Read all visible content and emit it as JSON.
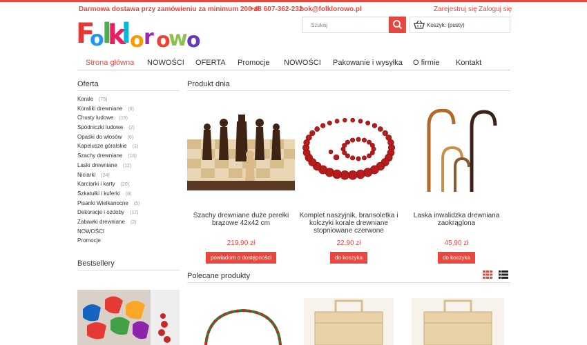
{
  "topbar": {
    "promo": "Darmowa dostawa przy zamówieniu za minimum 200 zł.",
    "phone": "+48 607-362-232",
    "email": "bok@folklorowo.pl",
    "register": "Zarejestruj się",
    "login": "Zaloguj się"
  },
  "brand": {
    "letters": [
      "F",
      "o",
      "l",
      "k",
      "l",
      "o",
      "r",
      "o",
      "w",
      "o"
    ],
    "colors": [
      "#e53935",
      "#2196f3",
      "#4caf50",
      "#e91e63",
      "#00bcd4",
      "#ff9800",
      "#9c27b0",
      "#f44336",
      "#8bc34a",
      "#673ab7"
    ]
  },
  "search": {
    "placeholder": "Szukaj"
  },
  "cart": {
    "label": "Koszyk: (pusty)"
  },
  "nav": {
    "items": [
      "Strona główna",
      "NOWOŚCI",
      "OFERTA",
      "Promocje",
      "NOWOŚCI",
      "Pakowanie i wysyłka",
      "O firmie",
      "Kontakt"
    ],
    "active_index": 0
  },
  "sidebar": {
    "title": "Oferta",
    "categories": [
      {
        "label": "Korale",
        "count": "(75)"
      },
      {
        "label": "Koraliki drewniane",
        "count": "(8)"
      },
      {
        "label": "Chusty ludowe",
        "count": "(15)"
      },
      {
        "label": "Spódniczki ludowe",
        "count": "(2)"
      },
      {
        "label": "Opaski do włosów",
        "count": "(6)"
      },
      {
        "label": "Kapelusze góralskie",
        "count": "(1)"
      },
      {
        "label": "Szachy drewniane",
        "count": "(16)"
      },
      {
        "label": "Laski drewniane",
        "count": "(12)"
      },
      {
        "label": "Niciarki",
        "count": "(24)"
      },
      {
        "label": "Karciarki i karty",
        "count": "(20)"
      },
      {
        "label": "Szkatułki i kuferki",
        "count": "(8)"
      },
      {
        "label": "Pisanki Wielkanocne",
        "count": "(5)"
      },
      {
        "label": "Dekoracje i ozdoby",
        "count": "(17)"
      },
      {
        "label": "Zabawki drewniane",
        "count": "(2)"
      },
      {
        "label": "NOWOŚCI",
        "count": ""
      },
      {
        "label": "Promocje",
        "count": ""
      }
    ],
    "bestsellers_title": "Bestsellery"
  },
  "product_of_day": {
    "title": "Produkt dnia",
    "products": [
      {
        "name": "Szachy drewniane duże perełki brązowe 42x42 cm",
        "price": "219,90 zł",
        "button": "powiadom o dostępności",
        "image": "chess-image"
      },
      {
        "name": "Komplet naszyjnik, bransoletka i kolczyki korale drewniane stopniowane czerwone",
        "price": "22,90 zł",
        "button": "do koszyka",
        "image": "red-beads-image"
      },
      {
        "name": "Laska inwalidzka drewniana zaokrąglona",
        "price": "45,90 zł",
        "button": "do koszyka",
        "image": "walking-canes-image"
      }
    ]
  },
  "recommended": {
    "title": "Polecane produkty"
  },
  "colors": {
    "accent": "#e8473f"
  }
}
